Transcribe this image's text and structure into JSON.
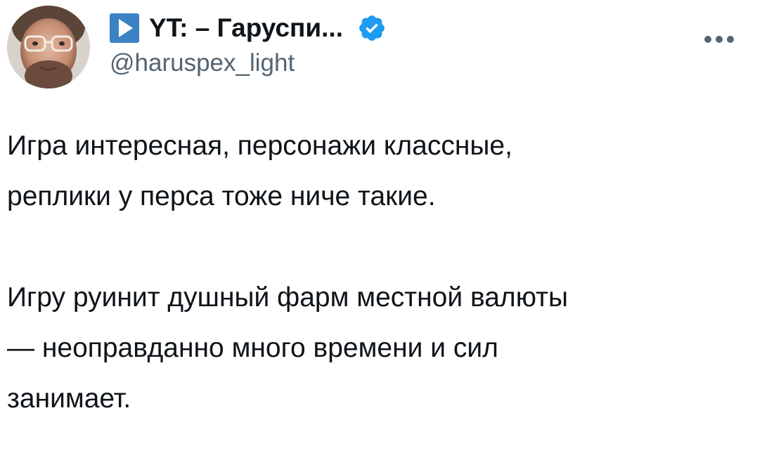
{
  "author": {
    "display_name": "YT: – Гаруспи...",
    "handle": "@haruspex_light",
    "name_icon": "play-triangle-icon",
    "verified_icon": "verified-badge-icon",
    "avatar_icon": "user-avatar-photo",
    "colors": {
      "name_icon_bg": "#3b82c4",
      "verified": "#1d9bf0",
      "handle": "#536471",
      "text": "#0f1419"
    }
  },
  "menu": {
    "more_icon": "more-options-icon"
  },
  "tweet": {
    "paragraph_1": "Игра интересная, персонажи классные,\nреплики у перса тоже ниче такие.",
    "paragraph_2": "Игру руинит душный фарм местной валюты\n— неоправданно много времени и сил\nзанимает."
  }
}
